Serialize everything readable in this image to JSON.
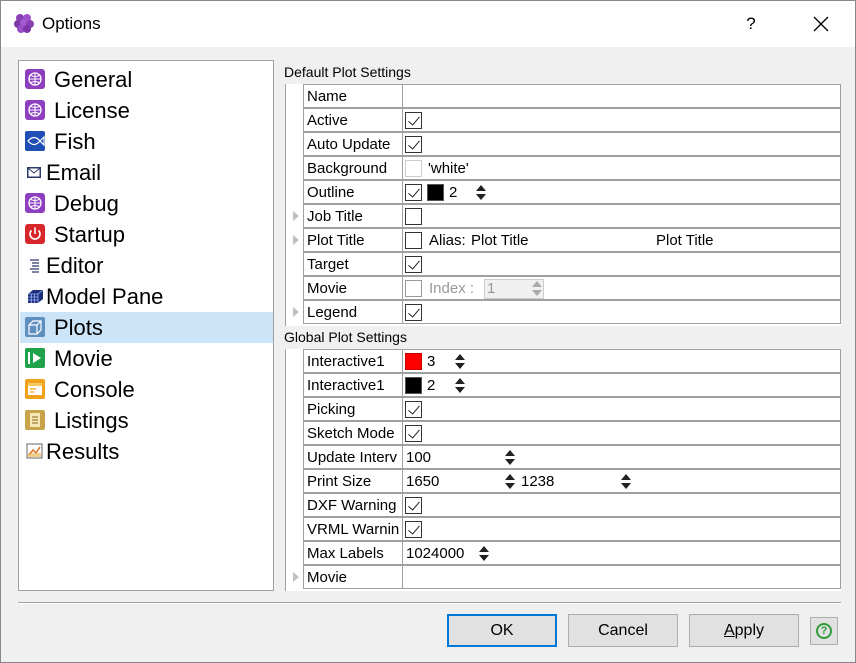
{
  "window": {
    "title": "Options",
    "help_glyph": "?"
  },
  "sidebar": {
    "items": [
      {
        "label": "General",
        "icon": "globe-icon"
      },
      {
        "label": "License",
        "icon": "globe-icon"
      },
      {
        "label": "Fish",
        "icon": "fish-icon"
      },
      {
        "label": "Email",
        "icon": "email-icon"
      },
      {
        "label": "Debug",
        "icon": "globe-icon"
      },
      {
        "label": "Startup",
        "icon": "power-icon"
      },
      {
        "label": "Editor",
        "icon": "editor-icon"
      },
      {
        "label": "Model Pane",
        "icon": "model-pane-icon"
      },
      {
        "label": "Plots",
        "icon": "plots-icon",
        "selected": true
      },
      {
        "label": "Movie",
        "icon": "movie-icon"
      },
      {
        "label": "Console",
        "icon": "console-icon"
      },
      {
        "label": "Listings",
        "icon": "listings-icon"
      },
      {
        "label": "Results",
        "icon": "results-icon"
      }
    ]
  },
  "default_plot": {
    "title": "Default Plot Settings",
    "rows": [
      {
        "label": "Name"
      },
      {
        "label": "Active",
        "checked": true
      },
      {
        "label": "Auto Update",
        "checked": true
      },
      {
        "label": "Background",
        "color": "#ffffff",
        "value": "'white'"
      },
      {
        "label": "Outline",
        "checked": true,
        "color": "#000000",
        "value": "2"
      },
      {
        "label": "Job Title",
        "checked": false,
        "expandable": true
      },
      {
        "label": "Plot Title",
        "checked": false,
        "expandable": true,
        "alias_label": "Alias:",
        "alias_value": "Plot Title",
        "display_value": "Plot Title"
      },
      {
        "label": "Target",
        "checked": true
      },
      {
        "label": "Movie",
        "checked": false,
        "index_label": "Index :",
        "index_value": "1"
      },
      {
        "label": "Legend",
        "checked": true,
        "expandable": true
      }
    ]
  },
  "global_plot": {
    "title": "Global Plot Settings",
    "rows": [
      {
        "label": "Interactive1",
        "color": "#ff0000",
        "value": "3"
      },
      {
        "label": "Interactive1",
        "color": "#000000",
        "value": "2"
      },
      {
        "label": "Picking",
        "checked": true
      },
      {
        "label": "Sketch Mode",
        "checked": true
      },
      {
        "label": "Update Interv",
        "value": "100"
      },
      {
        "label": "Print Size",
        "value": "1650",
        "value2": "1238"
      },
      {
        "label": "DXF Warning",
        "checked": true
      },
      {
        "label": "VRML Warnin",
        "checked": true
      },
      {
        "label": "Max Labels",
        "value": "1024000"
      },
      {
        "label": "Movie",
        "expandable": true
      }
    ]
  },
  "buttons": {
    "ok": "OK",
    "cancel": "Cancel",
    "apply_first": "A",
    "apply_rest": "pply"
  },
  "colors": {
    "selection": "#cce4f7",
    "accent": "#0078d7",
    "help_green": "#2e9c3a"
  }
}
